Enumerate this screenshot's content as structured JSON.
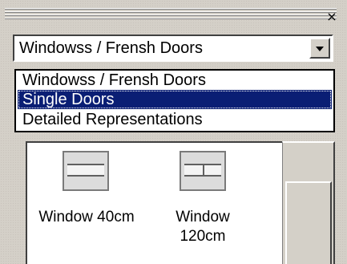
{
  "window": {
    "close_glyph": "×"
  },
  "combo": {
    "selected": "Windowss / Frensh Doors"
  },
  "dropdown": {
    "options": [
      "Windowss / Frensh Doors",
      "Single Doors",
      "Detailed Representations"
    ],
    "highlighted": "Single Doors"
  },
  "items": [
    {
      "label": "Window 40cm",
      "icon": "window-40cm-icon"
    },
    {
      "label_line1": "Window",
      "label_line2": "120cm",
      "icon": "window-120cm-icon"
    }
  ],
  "colors": {
    "selection": "#0a1e74",
    "face": "#d4d0c8"
  }
}
